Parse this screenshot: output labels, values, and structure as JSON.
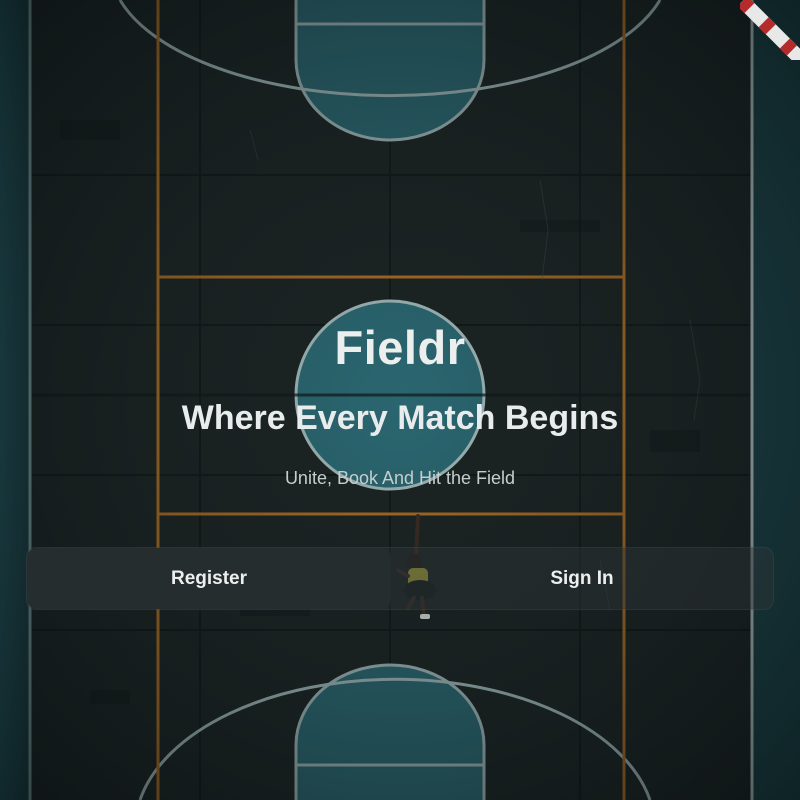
{
  "app": {
    "title": "Fieldr",
    "tagline": "Where Every Match Begins",
    "subtitle": "Unite, Book And Hit the Field"
  },
  "auth": {
    "register_label": "Register",
    "signin_label": "Sign In",
    "selected": "register"
  },
  "colors": {
    "background": "#0f1819",
    "court_teal": "#2c6e78",
    "court_line_white": "#9fb6b7",
    "court_line_orange": "#a86a22",
    "text_primary": "#ecefee",
    "text_secondary": "#c6cdcd",
    "button_active": "#252d2f"
  }
}
